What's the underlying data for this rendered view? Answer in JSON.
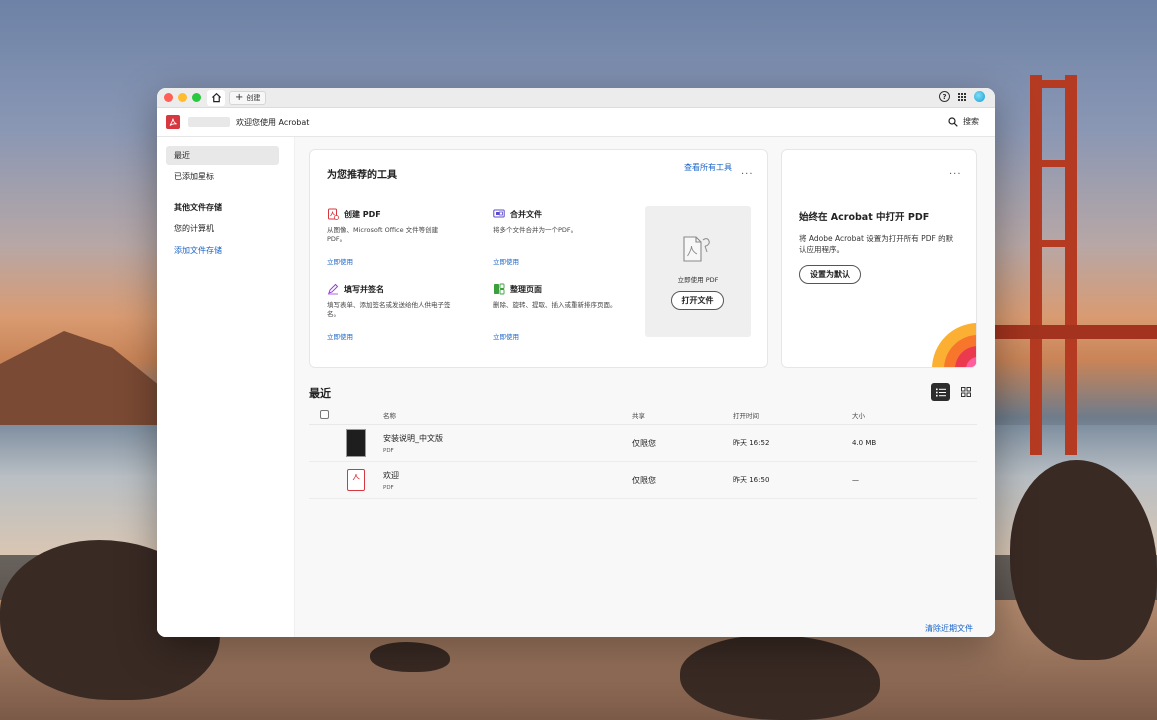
{
  "titlebar": {
    "tab_create": "创建"
  },
  "appbar": {
    "welcome": "欢迎您使用 Acrobat",
    "search": "搜索"
  },
  "sidebar": {
    "items": [
      {
        "label": "最近"
      },
      {
        "label": "已添加星标"
      }
    ],
    "storage_heading": "其他文件存储",
    "storage_items": [
      {
        "label": "您的计算机"
      }
    ],
    "add_storage": "添加文件存储"
  },
  "tools_card": {
    "title": "为您推荐的工具",
    "view_all": "查看所有工具",
    "more": "···",
    "tools": [
      {
        "name": "创建 PDF",
        "desc": "从图像、Microsoft Office 文件等创建 PDF。",
        "action": "立即使用",
        "icon": "create-pdf-icon"
      },
      {
        "name": "合并文件",
        "desc": "将多个文件合并为一个PDF。",
        "action": "立即使用",
        "icon": "combine-files-icon"
      },
      {
        "name": "填写并签名",
        "desc": "填写表单、添加签名或发送给他人供电子签名。",
        "action": "立即使用",
        "icon": "fill-sign-icon"
      },
      {
        "name": "整理页面",
        "desc": "删除、旋转、提取、插入或重新排序页面。",
        "action": "立即使用",
        "icon": "organize-pages-icon"
      }
    ],
    "drop_zone": {
      "text": "立即使用 PDF",
      "button": "打开文件"
    }
  },
  "default_card": {
    "title": "始终在 Acrobat 中打开 PDF",
    "desc": "将 Adobe Acrobat 设置为打开所有 PDF 的默认应用程序。",
    "button": "设置为默认",
    "more": "···"
  },
  "recent": {
    "title": "最近",
    "columns": {
      "name": "名称",
      "shared": "共享",
      "opened": "打开时间",
      "size": "大小"
    },
    "files": [
      {
        "name": "安装说明_中文版",
        "type": "PDF",
        "shared": "仅限您",
        "opened": "昨天 16:52",
        "size": "4.0 MB",
        "thumb": "document-thumbnail"
      },
      {
        "name": "欢迎",
        "type": "PDF",
        "shared": "仅限您",
        "opened": "昨天 16:50",
        "size": "—",
        "thumb": "pdf-file-icon"
      }
    ],
    "clear": "清除近期文件"
  },
  "colors": {
    "accent_blue": "#1a64c7",
    "acrobat_red": "#d7373f"
  }
}
